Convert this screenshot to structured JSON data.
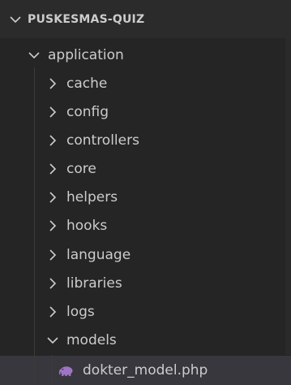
{
  "explorer": {
    "root": {
      "label": "PUSKESMAS-QUIZ",
      "expanded": true
    },
    "folder": {
      "label": "application",
      "expanded": true
    },
    "children": [
      {
        "label": "cache",
        "expanded": false
      },
      {
        "label": "config",
        "expanded": false
      },
      {
        "label": "controllers",
        "expanded": false
      },
      {
        "label": "core",
        "expanded": false
      },
      {
        "label": "helpers",
        "expanded": false
      },
      {
        "label": "hooks",
        "expanded": false
      },
      {
        "label": "language",
        "expanded": false
      },
      {
        "label": "libraries",
        "expanded": false
      },
      {
        "label": "logs",
        "expanded": false
      },
      {
        "label": "models",
        "expanded": true
      }
    ],
    "selected_file": {
      "label": "dokter_model.php",
      "icon": "php-elephant-icon"
    }
  },
  "colors": {
    "background": "#252526",
    "header": "#2b2b2c",
    "text": "#cccccc",
    "selected": "#37373d",
    "php_icon": "#a074c4"
  }
}
